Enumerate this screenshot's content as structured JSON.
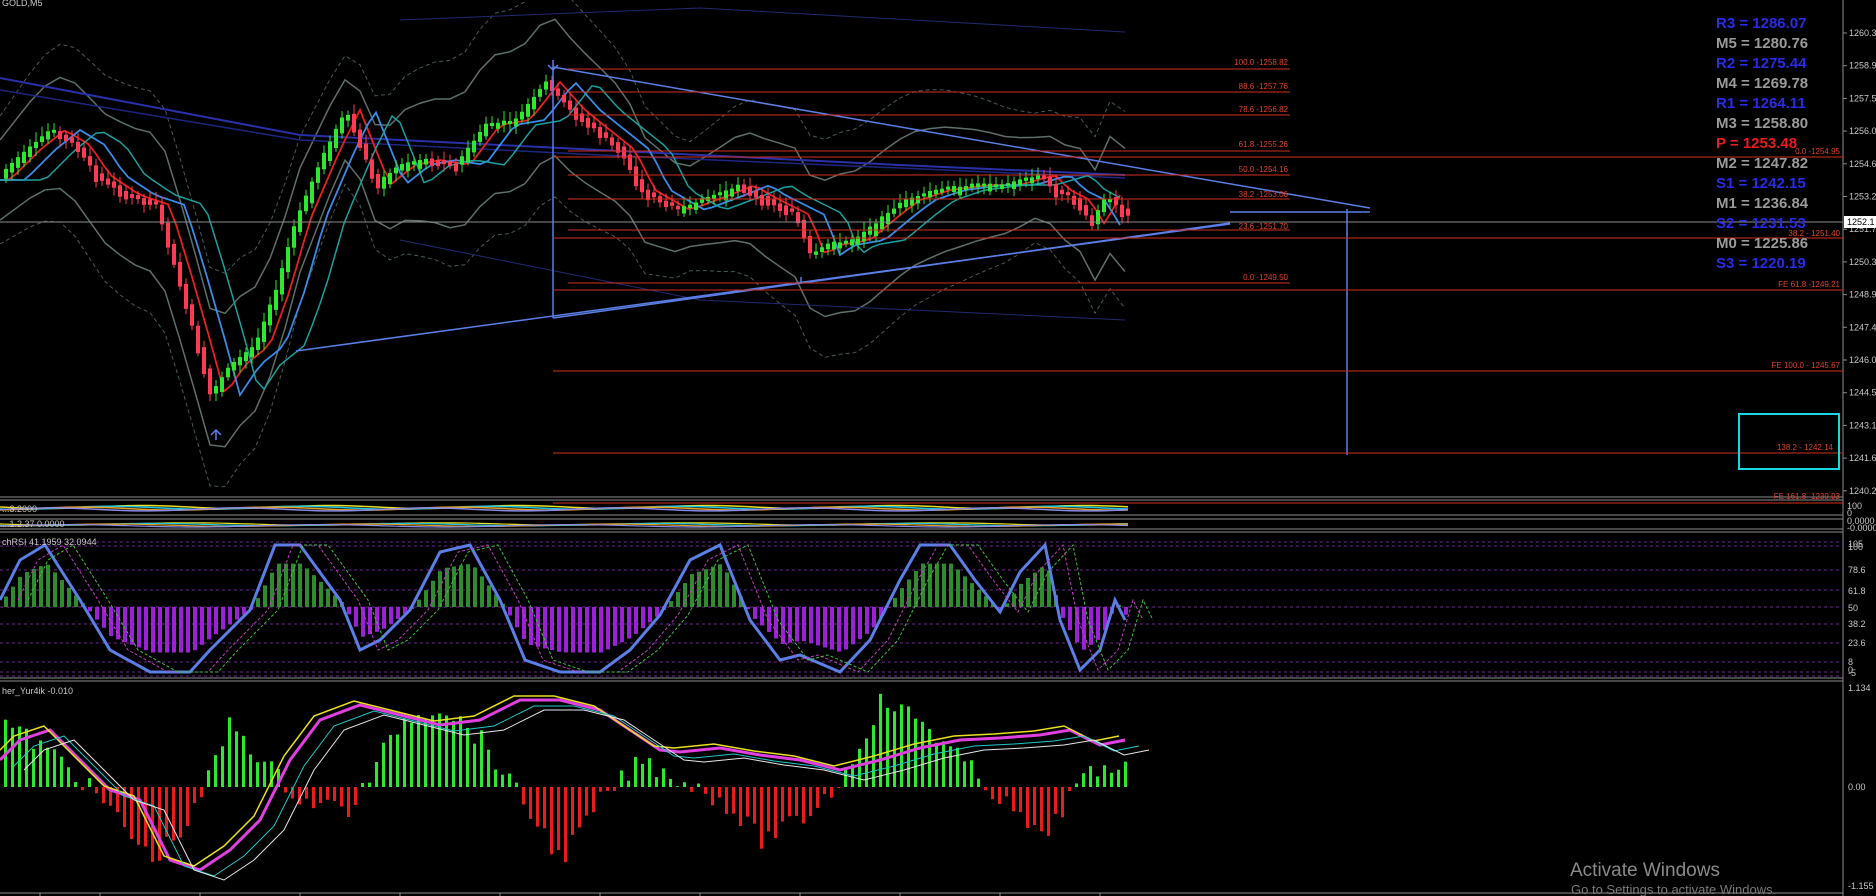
{
  "symbol": "GOLD,M5",
  "price_axis": [
    "1260.3",
    "1258.9",
    "1257.5",
    "1256.0",
    "1254.6",
    "1253.2",
    "1251.7",
    "1250.3",
    "1248.9",
    "1247.4",
    "1246.0",
    "1244.5",
    "1243.1",
    "1241.6",
    "1240.2"
  ],
  "current_price": "1252.1",
  "pivots": [
    {
      "label": "R3 = 1286.07",
      "color": "#2a2ae8"
    },
    {
      "label": "M5 = 1280.76",
      "color": "#9a9a9a"
    },
    {
      "label": "R2 = 1275.44",
      "color": "#2a2ae8"
    },
    {
      "label": "M4 = 1269.78",
      "color": "#9a9a9a"
    },
    {
      "label": "R1 = 1264.11",
      "color": "#2a2ae8"
    },
    {
      "label": "M3 = 1258.80",
      "color": "#9a9a9a"
    },
    {
      "label": "P = 1253.48",
      "color": "#e81c1c"
    },
    {
      "label": "M2 = 1247.82",
      "color": "#9a9a9a"
    },
    {
      "label": "S1 = 1242.15",
      "color": "#2a2ae8"
    },
    {
      "label": "M1 = 1236.84",
      "color": "#9a9a9a"
    },
    {
      "label": "S2 = 1231.53",
      "color": "#2a2ae8"
    },
    {
      "label": "M0 = 1225.86",
      "color": "#9a9a9a"
    },
    {
      "label": "S3 = 1220.19",
      "color": "#2a2ae8"
    }
  ],
  "fib_levels": [
    "100.0 -1258.82",
    "88.6 -1257.76",
    "78.6 -1256.82",
    "61.8 -1255.26",
    "50.0 -1254.16",
    "38.2 -1253.06",
    "23.6 -1251.70",
    "0.0 -1249.50"
  ],
  "fe_levels": [
    "0.0 -1254.95",
    "38.2 - 1251.40",
    "FE 61.8 -1249.21",
    "FE 100.0 - 1245.67",
    "138.2 - 1242.14",
    "FE 161.8 -1239.93"
  ],
  "indicator1": {
    "label": "...3.2000",
    "axis": [
      "100",
      "0"
    ]
  },
  "indicator2": {
    "label": "...1.2.37 0.0000",
    "axis": [
      "0.0000",
      "-0.0000"
    ]
  },
  "stoch": {
    "label": "chRSI 41.1959 32.0944",
    "axis": [
      "105",
      "100",
      "78.6",
      "61.8",
      "50",
      "38.2",
      "23.6",
      "8",
      "0",
      "-5"
    ]
  },
  "fisher": {
    "label": "her_Yur4ik -0.010",
    "axis": [
      "1.134",
      "0.00",
      "-1.155"
    ]
  },
  "watermark": {
    "title": "Activate Windows",
    "subtitle": "Go to Settings to activate Windows."
  },
  "colors": {
    "bull": "#2ee82e",
    "bear": "#ff3a55",
    "trend": "#5b7fe6",
    "fib": "#d0301e",
    "box": "#16d8e0"
  }
}
